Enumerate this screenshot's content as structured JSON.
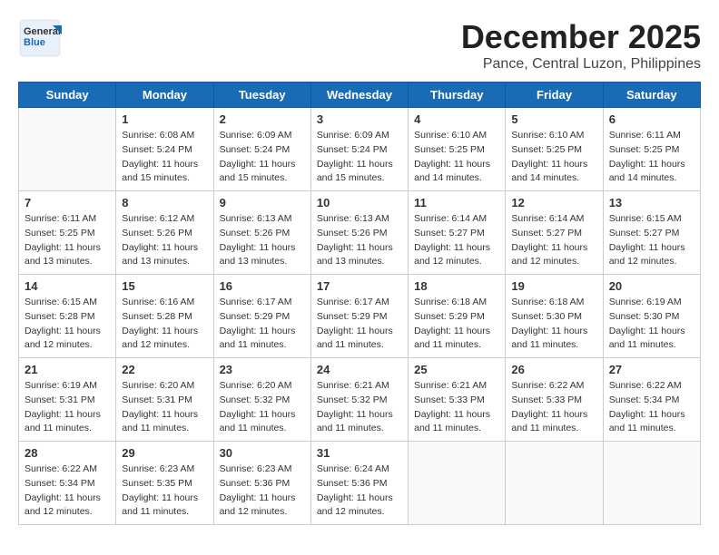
{
  "header": {
    "logo_general": "General",
    "logo_blue": "Blue",
    "month": "December 2025",
    "location": "Pance, Central Luzon, Philippines"
  },
  "weekdays": [
    "Sunday",
    "Monday",
    "Tuesday",
    "Wednesday",
    "Thursday",
    "Friday",
    "Saturday"
  ],
  "weeks": [
    [
      {
        "day": "",
        "sunrise": "",
        "sunset": "",
        "daylight": ""
      },
      {
        "day": "1",
        "sunrise": "Sunrise: 6:08 AM",
        "sunset": "Sunset: 5:24 PM",
        "daylight": "Daylight: 11 hours and 15 minutes."
      },
      {
        "day": "2",
        "sunrise": "Sunrise: 6:09 AM",
        "sunset": "Sunset: 5:24 PM",
        "daylight": "Daylight: 11 hours and 15 minutes."
      },
      {
        "day": "3",
        "sunrise": "Sunrise: 6:09 AM",
        "sunset": "Sunset: 5:24 PM",
        "daylight": "Daylight: 11 hours and 15 minutes."
      },
      {
        "day": "4",
        "sunrise": "Sunrise: 6:10 AM",
        "sunset": "Sunset: 5:25 PM",
        "daylight": "Daylight: 11 hours and 14 minutes."
      },
      {
        "day": "5",
        "sunrise": "Sunrise: 6:10 AM",
        "sunset": "Sunset: 5:25 PM",
        "daylight": "Daylight: 11 hours and 14 minutes."
      },
      {
        "day": "6",
        "sunrise": "Sunrise: 6:11 AM",
        "sunset": "Sunset: 5:25 PM",
        "daylight": "Daylight: 11 hours and 14 minutes."
      }
    ],
    [
      {
        "day": "7",
        "sunrise": "Sunrise: 6:11 AM",
        "sunset": "Sunset: 5:25 PM",
        "daylight": "Daylight: 11 hours and 13 minutes."
      },
      {
        "day": "8",
        "sunrise": "Sunrise: 6:12 AM",
        "sunset": "Sunset: 5:26 PM",
        "daylight": "Daylight: 11 hours and 13 minutes."
      },
      {
        "day": "9",
        "sunrise": "Sunrise: 6:13 AM",
        "sunset": "Sunset: 5:26 PM",
        "daylight": "Daylight: 11 hours and 13 minutes."
      },
      {
        "day": "10",
        "sunrise": "Sunrise: 6:13 AM",
        "sunset": "Sunset: 5:26 PM",
        "daylight": "Daylight: 11 hours and 13 minutes."
      },
      {
        "day": "11",
        "sunrise": "Sunrise: 6:14 AM",
        "sunset": "Sunset: 5:27 PM",
        "daylight": "Daylight: 11 hours and 12 minutes."
      },
      {
        "day": "12",
        "sunrise": "Sunrise: 6:14 AM",
        "sunset": "Sunset: 5:27 PM",
        "daylight": "Daylight: 11 hours and 12 minutes."
      },
      {
        "day": "13",
        "sunrise": "Sunrise: 6:15 AM",
        "sunset": "Sunset: 5:27 PM",
        "daylight": "Daylight: 11 hours and 12 minutes."
      }
    ],
    [
      {
        "day": "14",
        "sunrise": "Sunrise: 6:15 AM",
        "sunset": "Sunset: 5:28 PM",
        "daylight": "Daylight: 11 hours and 12 minutes."
      },
      {
        "day": "15",
        "sunrise": "Sunrise: 6:16 AM",
        "sunset": "Sunset: 5:28 PM",
        "daylight": "Daylight: 11 hours and 12 minutes."
      },
      {
        "day": "16",
        "sunrise": "Sunrise: 6:17 AM",
        "sunset": "Sunset: 5:29 PM",
        "daylight": "Daylight: 11 hours and 11 minutes."
      },
      {
        "day": "17",
        "sunrise": "Sunrise: 6:17 AM",
        "sunset": "Sunset: 5:29 PM",
        "daylight": "Daylight: 11 hours and 11 minutes."
      },
      {
        "day": "18",
        "sunrise": "Sunrise: 6:18 AM",
        "sunset": "Sunset: 5:29 PM",
        "daylight": "Daylight: 11 hours and 11 minutes."
      },
      {
        "day": "19",
        "sunrise": "Sunrise: 6:18 AM",
        "sunset": "Sunset: 5:30 PM",
        "daylight": "Daylight: 11 hours and 11 minutes."
      },
      {
        "day": "20",
        "sunrise": "Sunrise: 6:19 AM",
        "sunset": "Sunset: 5:30 PM",
        "daylight": "Daylight: 11 hours and 11 minutes."
      }
    ],
    [
      {
        "day": "21",
        "sunrise": "Sunrise: 6:19 AM",
        "sunset": "Sunset: 5:31 PM",
        "daylight": "Daylight: 11 hours and 11 minutes."
      },
      {
        "day": "22",
        "sunrise": "Sunrise: 6:20 AM",
        "sunset": "Sunset: 5:31 PM",
        "daylight": "Daylight: 11 hours and 11 minutes."
      },
      {
        "day": "23",
        "sunrise": "Sunrise: 6:20 AM",
        "sunset": "Sunset: 5:32 PM",
        "daylight": "Daylight: 11 hours and 11 minutes."
      },
      {
        "day": "24",
        "sunrise": "Sunrise: 6:21 AM",
        "sunset": "Sunset: 5:32 PM",
        "daylight": "Daylight: 11 hours and 11 minutes."
      },
      {
        "day": "25",
        "sunrise": "Sunrise: 6:21 AM",
        "sunset": "Sunset: 5:33 PM",
        "daylight": "Daylight: 11 hours and 11 minutes."
      },
      {
        "day": "26",
        "sunrise": "Sunrise: 6:22 AM",
        "sunset": "Sunset: 5:33 PM",
        "daylight": "Daylight: 11 hours and 11 minutes."
      },
      {
        "day": "27",
        "sunrise": "Sunrise: 6:22 AM",
        "sunset": "Sunset: 5:34 PM",
        "daylight": "Daylight: 11 hours and 11 minutes."
      }
    ],
    [
      {
        "day": "28",
        "sunrise": "Sunrise: 6:22 AM",
        "sunset": "Sunset: 5:34 PM",
        "daylight": "Daylight: 11 hours and 12 minutes."
      },
      {
        "day": "29",
        "sunrise": "Sunrise: 6:23 AM",
        "sunset": "Sunset: 5:35 PM",
        "daylight": "Daylight: 11 hours and 11 minutes."
      },
      {
        "day": "30",
        "sunrise": "Sunrise: 6:23 AM",
        "sunset": "Sunset: 5:36 PM",
        "daylight": "Daylight: 11 hours and 12 minutes."
      },
      {
        "day": "31",
        "sunrise": "Sunrise: 6:24 AM",
        "sunset": "Sunset: 5:36 PM",
        "daylight": "Daylight: 11 hours and 12 minutes."
      },
      {
        "day": "",
        "sunrise": "",
        "sunset": "",
        "daylight": ""
      },
      {
        "day": "",
        "sunrise": "",
        "sunset": "",
        "daylight": ""
      },
      {
        "day": "",
        "sunrise": "",
        "sunset": "",
        "daylight": ""
      }
    ]
  ]
}
